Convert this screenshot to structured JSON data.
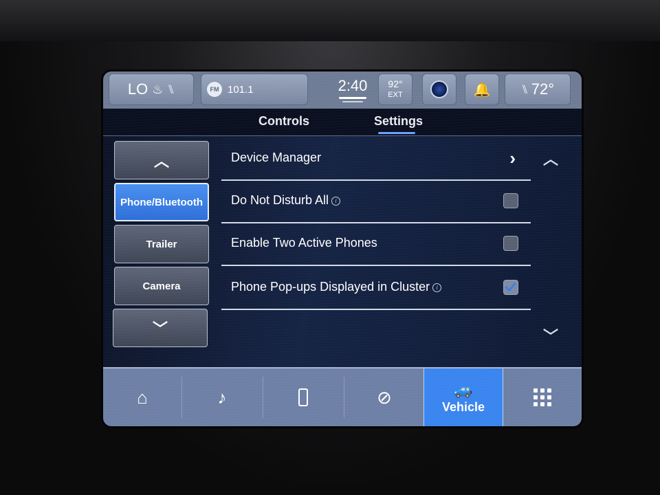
{
  "status_bar": {
    "fan_level": "LO",
    "radio_band": "FM",
    "radio_station": "101.1",
    "time": "2:40",
    "outside_temp": "92°",
    "outside_temp_label": "EXT",
    "cabin_temp": "72°"
  },
  "tabs": [
    {
      "label": "Controls"
    },
    {
      "label": "Settings"
    }
  ],
  "side_menu": {
    "items": [
      {
        "label": "Phone/Bluetooth"
      },
      {
        "label": "Trailer"
      },
      {
        "label": "Camera"
      }
    ]
  },
  "settings": {
    "rows": [
      {
        "label": "Device Manager"
      },
      {
        "label": "Do Not Disturb All",
        "checked": false
      },
      {
        "label": "Enable Two Active Phones",
        "checked": false
      },
      {
        "label": "Phone Pop-ups Displayed in Cluster",
        "checked": true
      }
    ]
  },
  "nav": {
    "vehicle_label": "Vehicle"
  },
  "colors": {
    "accent": "#3a85ef",
    "status_bar": "#6f7c95",
    "nav_bar": "#6f80a6"
  }
}
